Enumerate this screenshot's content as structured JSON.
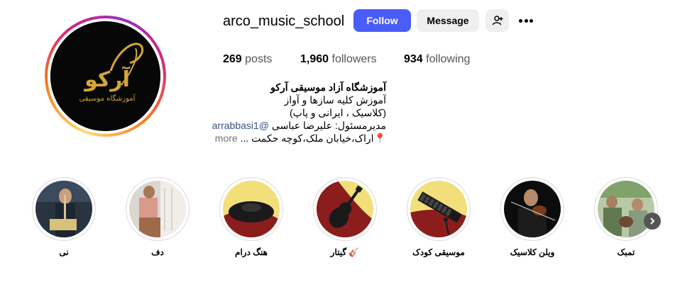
{
  "profile": {
    "username": "arco_music_school",
    "follow_label": "Follow",
    "message_label": "Message",
    "add_user_icon": "add-user-icon",
    "more_icon": "more-options-icon"
  },
  "stats": {
    "posts_count": "269",
    "posts_label": "posts",
    "followers_count": "1,960",
    "followers_label": "followers",
    "following_count": "934",
    "following_label": "following"
  },
  "bio": {
    "name": "آموزشگاه آزاد موسیقی آرکو",
    "line1": "آموزش کلیه سازها و آواز",
    "line2": "(کلاسیک ، ایرانی و پاپ)",
    "line3_text": "مدیرمسئول: علیرضا عباسی",
    "line3_link": "@arrabbasi1",
    "line4_text": "📍اراک،خیابان ملک،کوچه حکمت ...",
    "more_label": "more"
  },
  "logo_text": {
    "main": "آرکو",
    "sub": "آموزشگاه موسیقی"
  },
  "highlights": [
    {
      "label": "نی",
      "icon": "ney-player-photo"
    },
    {
      "label": "دف",
      "icon": "daf-photo"
    },
    {
      "label": "هنگ درام",
      "icon": "hang-drum-icon"
    },
    {
      "label": "🎸 گیتار",
      "icon": "guitar-icon"
    },
    {
      "label": "موسیقی کودک",
      "icon": "xylophone-icon"
    },
    {
      "label": "ویلن کلاسیک",
      "icon": "violin-player-photo"
    },
    {
      "label": "تمبک",
      "icon": "tombak-photo"
    }
  ],
  "colors": {
    "accent": "#4a5df9",
    "logo_gold": "#d4a53a",
    "highlight_red": "#8b1d1d",
    "highlight_yellow": "#f2df7a"
  }
}
